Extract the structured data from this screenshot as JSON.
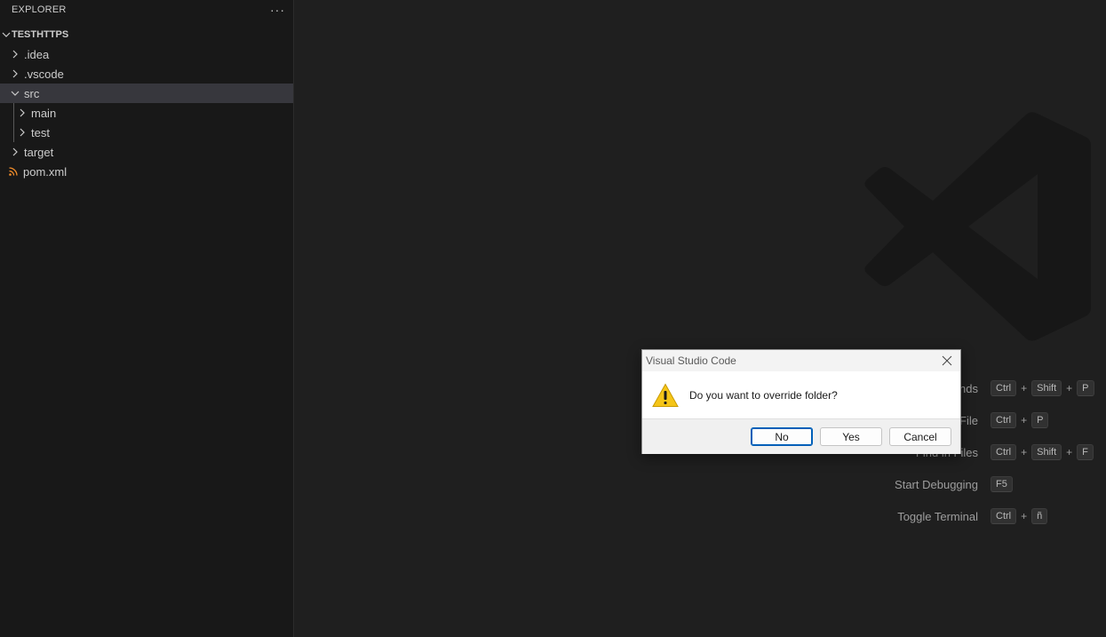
{
  "sidebar": {
    "header_title": "EXPLORER",
    "more_label": "···",
    "workspace_name": "TESTHTTPS",
    "items": [
      {
        "label": ".idea",
        "icon": "chevron-right-icon"
      },
      {
        "label": ".vscode",
        "icon": "chevron-right-icon"
      },
      {
        "label": "src",
        "icon": "chevron-down-icon"
      },
      {
        "label": "main",
        "icon": "chevron-right-icon"
      },
      {
        "label": "test",
        "icon": "chevron-right-icon"
      },
      {
        "label": "target",
        "icon": "chevron-right-icon"
      },
      {
        "label": "pom.xml",
        "icon": "rss-file-icon"
      }
    ]
  },
  "editor": {
    "watermark": "vscode-logo-icon",
    "shortcuts": [
      {
        "label": "Show All Commands",
        "keys": [
          "Ctrl",
          "+",
          "Shift",
          "+",
          "P"
        ]
      },
      {
        "label": "Go to File",
        "keys": [
          "Ctrl",
          "+",
          "P"
        ]
      },
      {
        "label": "Find in Files",
        "keys": [
          "Ctrl",
          "+",
          "Shift",
          "+",
          "F"
        ]
      },
      {
        "label": "Start Debugging",
        "keys": [
          "F5"
        ]
      },
      {
        "label": "Toggle Terminal",
        "keys": [
          "Ctrl",
          "+",
          "ñ"
        ]
      }
    ]
  },
  "dialog": {
    "title": "Visual Studio Code",
    "message": "Do you want to override folder?",
    "icon": "warning-icon",
    "buttons": {
      "no": "No",
      "yes": "Yes",
      "cancel": "Cancel"
    }
  },
  "colors": {
    "accent": "#005fb8",
    "rss": "#f08c2a",
    "warning": "#f5c518"
  }
}
